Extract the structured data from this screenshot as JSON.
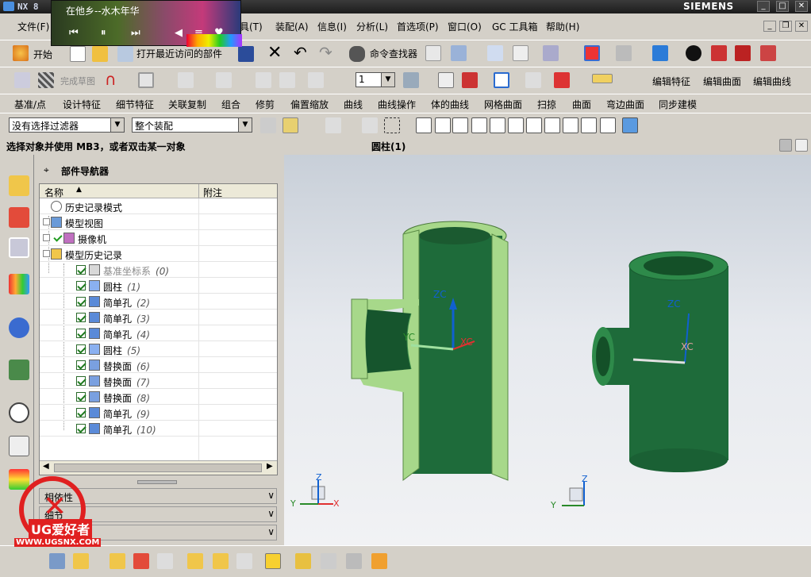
{
  "window": {
    "title": "NX 8",
    "brand": "SIEMENS",
    "min": "_",
    "max": "□",
    "close": "✕"
  },
  "player": {
    "song": "在他乡--水木年华"
  },
  "menu": [
    "文件(F)",
    "工具(T)",
    "装配(A)",
    "信息(I)",
    "分析(L)",
    "首选项(P)",
    "窗口(O)",
    "GC 工具箱",
    "帮助(H)"
  ],
  "toolbar1": {
    "start": "开始",
    "recent": "打开最近访问的部件",
    "finder": "命令查找器"
  },
  "toolbar2": {
    "finish_sketch": "完成草图",
    "layer": "1",
    "edit_feature": "编辑特征",
    "edit_surface": "编辑曲面",
    "edit_curve": "编辑曲线"
  },
  "toolbar3": [
    "基准/点",
    "设计特征",
    "细节特征",
    "关联复制",
    "组合",
    "修剪",
    "偏置缩放",
    "曲线",
    "曲线操作",
    "体的曲线",
    "网格曲面",
    "扫掠",
    "曲面",
    "弯边曲面",
    "同步建模"
  ],
  "selection": {
    "filter": "没有选择过滤器",
    "scope": "整个装配"
  },
  "status": {
    "prompt": "选择对象并使用 MB3，或者双击某一对象",
    "selected": "圆柱(1)"
  },
  "navigator": {
    "title": "部件导航器",
    "col_name": "名称",
    "col_note": "附注",
    "rows": [
      {
        "label": "历史记录模式",
        "num": ""
      },
      {
        "label": "模型视图",
        "num": ""
      },
      {
        "label": "摄像机",
        "num": ""
      },
      {
        "label": "模型历史记录",
        "num": ""
      },
      {
        "label": "基准坐标系",
        "num": "(0)"
      },
      {
        "label": "圆柱",
        "num": "(1)"
      },
      {
        "label": "简单孔",
        "num": "(2)"
      },
      {
        "label": "简单孔",
        "num": "(3)"
      },
      {
        "label": "简单孔",
        "num": "(4)"
      },
      {
        "label": "圆柱",
        "num": "(5)"
      },
      {
        "label": "替换面",
        "num": "(6)"
      },
      {
        "label": "替换面",
        "num": "(7)"
      },
      {
        "label": "替换面",
        "num": "(8)"
      },
      {
        "label": "简单孔",
        "num": "(9)"
      },
      {
        "label": "简单孔",
        "num": "(10)"
      }
    ],
    "panels": [
      "相依性",
      "细节",
      "预览"
    ]
  },
  "viewport": {
    "zc": "ZC",
    "yc": "YC",
    "xc": "XC",
    "z": "Z",
    "x": "X",
    "y": "Y"
  },
  "watermark": {
    "brand": "UG爱好者",
    "url": "WWW.UGSNX.COM"
  },
  "colors": {
    "body": "#1e6b3a",
    "cut": "#a7d88a",
    "viewport_top": "#c8cfd8"
  }
}
